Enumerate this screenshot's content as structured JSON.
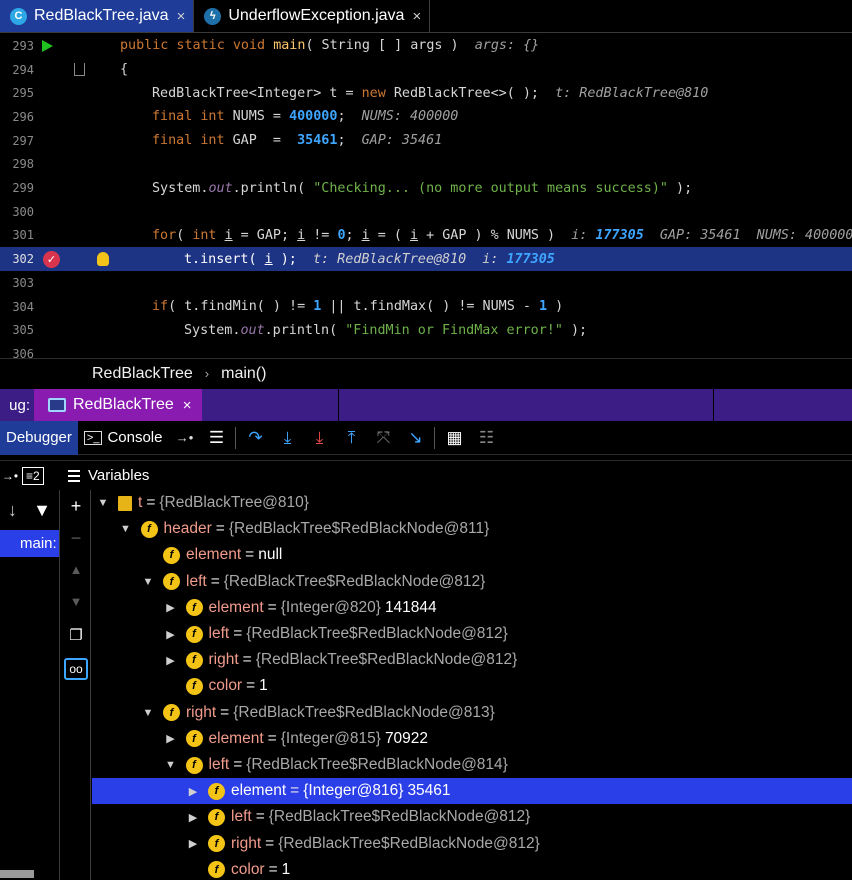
{
  "editor_tabs": [
    {
      "label": "RedBlackTree.java",
      "icon": "C",
      "active": true
    },
    {
      "label": "UnderflowException.java",
      "icon": "exception-icon",
      "active": false
    }
  ],
  "close_glyph": "×",
  "code_lines": [
    {
      "n": "293",
      "parts": [
        "public static void ",
        "main",
        "( String [ ] args )  ",
        "args: {}"
      ]
    },
    {
      "n": "294",
      "parts": [
        "{"
      ]
    },
    {
      "n": "295",
      "parts": [
        "RedBlackTree<Integer> t = ",
        "new",
        " RedBlackTree<>( );  ",
        "t: RedBlackTree@810"
      ]
    },
    {
      "n": "296",
      "parts": [
        "final int",
        " NUMS = ",
        "400000",
        ";  ",
        "NUMS: 400000"
      ]
    },
    {
      "n": "297",
      "parts": [
        "final int",
        " GAP  =  ",
        "35461",
        ";  ",
        "GAP: 35461"
      ]
    },
    {
      "n": "298",
      "parts": []
    },
    {
      "n": "299",
      "parts": [
        "System.",
        "out",
        ".println( ",
        "\"Checking... (no more output means success)\"",
        " );"
      ]
    },
    {
      "n": "300",
      "parts": []
    },
    {
      "n": "301",
      "parts": [
        "for",
        "( ",
        "int",
        " ",
        "i",
        " = GAP; ",
        "i",
        " != ",
        "0",
        "; ",
        "i",
        " = ( ",
        "i",
        " + GAP ) % NUMS )  ",
        "i: ",
        "177305",
        "  GAP: 35461  NUMS: 400000"
      ]
    },
    {
      "n": "302",
      "parts": [
        "t.insert( ",
        "i",
        " );  ",
        "t: RedBlackTree@810  i: ",
        "177305"
      ]
    },
    {
      "n": "303",
      "parts": []
    },
    {
      "n": "304",
      "parts": [
        "if",
        "( t.findMin( ) != ",
        "1",
        " || t.findMax( ) != NUMS - ",
        "1",
        " )"
      ]
    },
    {
      "n": "305",
      "parts": [
        "System.",
        "out",
        ".println( ",
        "\"FindMin or FindMax error!\"",
        " );"
      ]
    },
    {
      "n": "306",
      "parts": []
    }
  ],
  "breadcrumb": {
    "class_name": "RedBlackTree",
    "separator": "›",
    "method": "main()"
  },
  "debug_header": {
    "label": "ug:",
    "session_tab": "RedBlackTree"
  },
  "debug_toolbar": {
    "debugger_tab": "Debugger",
    "console_tab": "Console",
    "console_icon_glyph": ">_",
    "buttons": [
      "menu-icon",
      "show-execution-point-icon",
      "step-over-icon",
      "step-into-icon",
      "force-step-into-icon",
      "step-out-icon",
      "drop-frame-icon",
      "run-to-cursor-icon",
      "evaluate-expression-icon",
      "trace-icon"
    ]
  },
  "variables_panel": {
    "title": "Variables",
    "frames_count_label": "≡2",
    "frame_selected": "main:",
    "tree": [
      {
        "depth": 0,
        "arrow": "down",
        "icon": "root",
        "name": "t",
        "type": "{RedBlackTree@810}",
        "value": ""
      },
      {
        "depth": 1,
        "arrow": "down",
        "icon": "f",
        "name": "header",
        "type": "{RedBlackTree$RedBlackNode@811}",
        "value": ""
      },
      {
        "depth": 2,
        "arrow": "none",
        "icon": "f",
        "name": "element",
        "type": "",
        "value": "null"
      },
      {
        "depth": 2,
        "arrow": "down",
        "icon": "f",
        "name": "left",
        "type": "{RedBlackTree$RedBlackNode@812}",
        "value": ""
      },
      {
        "depth": 3,
        "arrow": "right",
        "icon": "f",
        "name": "element",
        "type": "{Integer@820}",
        "value": "141844"
      },
      {
        "depth": 3,
        "arrow": "right",
        "icon": "f",
        "name": "left",
        "type": "{RedBlackTree$RedBlackNode@812}",
        "value": ""
      },
      {
        "depth": 3,
        "arrow": "right",
        "icon": "f",
        "name": "right",
        "type": "{RedBlackTree$RedBlackNode@812}",
        "value": ""
      },
      {
        "depth": 3,
        "arrow": "none",
        "icon": "f",
        "name": "color",
        "type": "",
        "value": "1"
      },
      {
        "depth": 2,
        "arrow": "down",
        "icon": "f",
        "name": "right",
        "type": "{RedBlackTree$RedBlackNode@813}",
        "value": ""
      },
      {
        "depth": 3,
        "arrow": "right",
        "icon": "f",
        "name": "element",
        "type": "{Integer@815}",
        "value": "70922"
      },
      {
        "depth": 3,
        "arrow": "down",
        "icon": "f",
        "name": "left",
        "type": "{RedBlackTree$RedBlackNode@814}",
        "value": ""
      },
      {
        "depth": 4,
        "arrow": "right",
        "icon": "f",
        "name": "element",
        "type": "{Integer@816}",
        "value": "35461",
        "selected": true
      },
      {
        "depth": 4,
        "arrow": "right",
        "icon": "f",
        "name": "left",
        "type": "{RedBlackTree$RedBlackNode@812}",
        "value": ""
      },
      {
        "depth": 4,
        "arrow": "right",
        "icon": "f",
        "name": "right",
        "type": "{RedBlackTree$RedBlackNode@812}",
        "value": ""
      },
      {
        "depth": 4,
        "arrow": "none",
        "icon": "f",
        "name": "color",
        "type": "",
        "value": "1"
      }
    ]
  },
  "colors": {
    "active_tab": "#1e3c98",
    "exec_line": "#1d3384",
    "debug_header": "#3c1d86",
    "session_tab": "#8a1bb1",
    "selection": "#2b3fe8",
    "field_icon": "#f3c316",
    "var_name": "#f29c8d",
    "keyword": "#cc7832",
    "string": "#6fb24a",
    "number": "#3ea6ff"
  }
}
